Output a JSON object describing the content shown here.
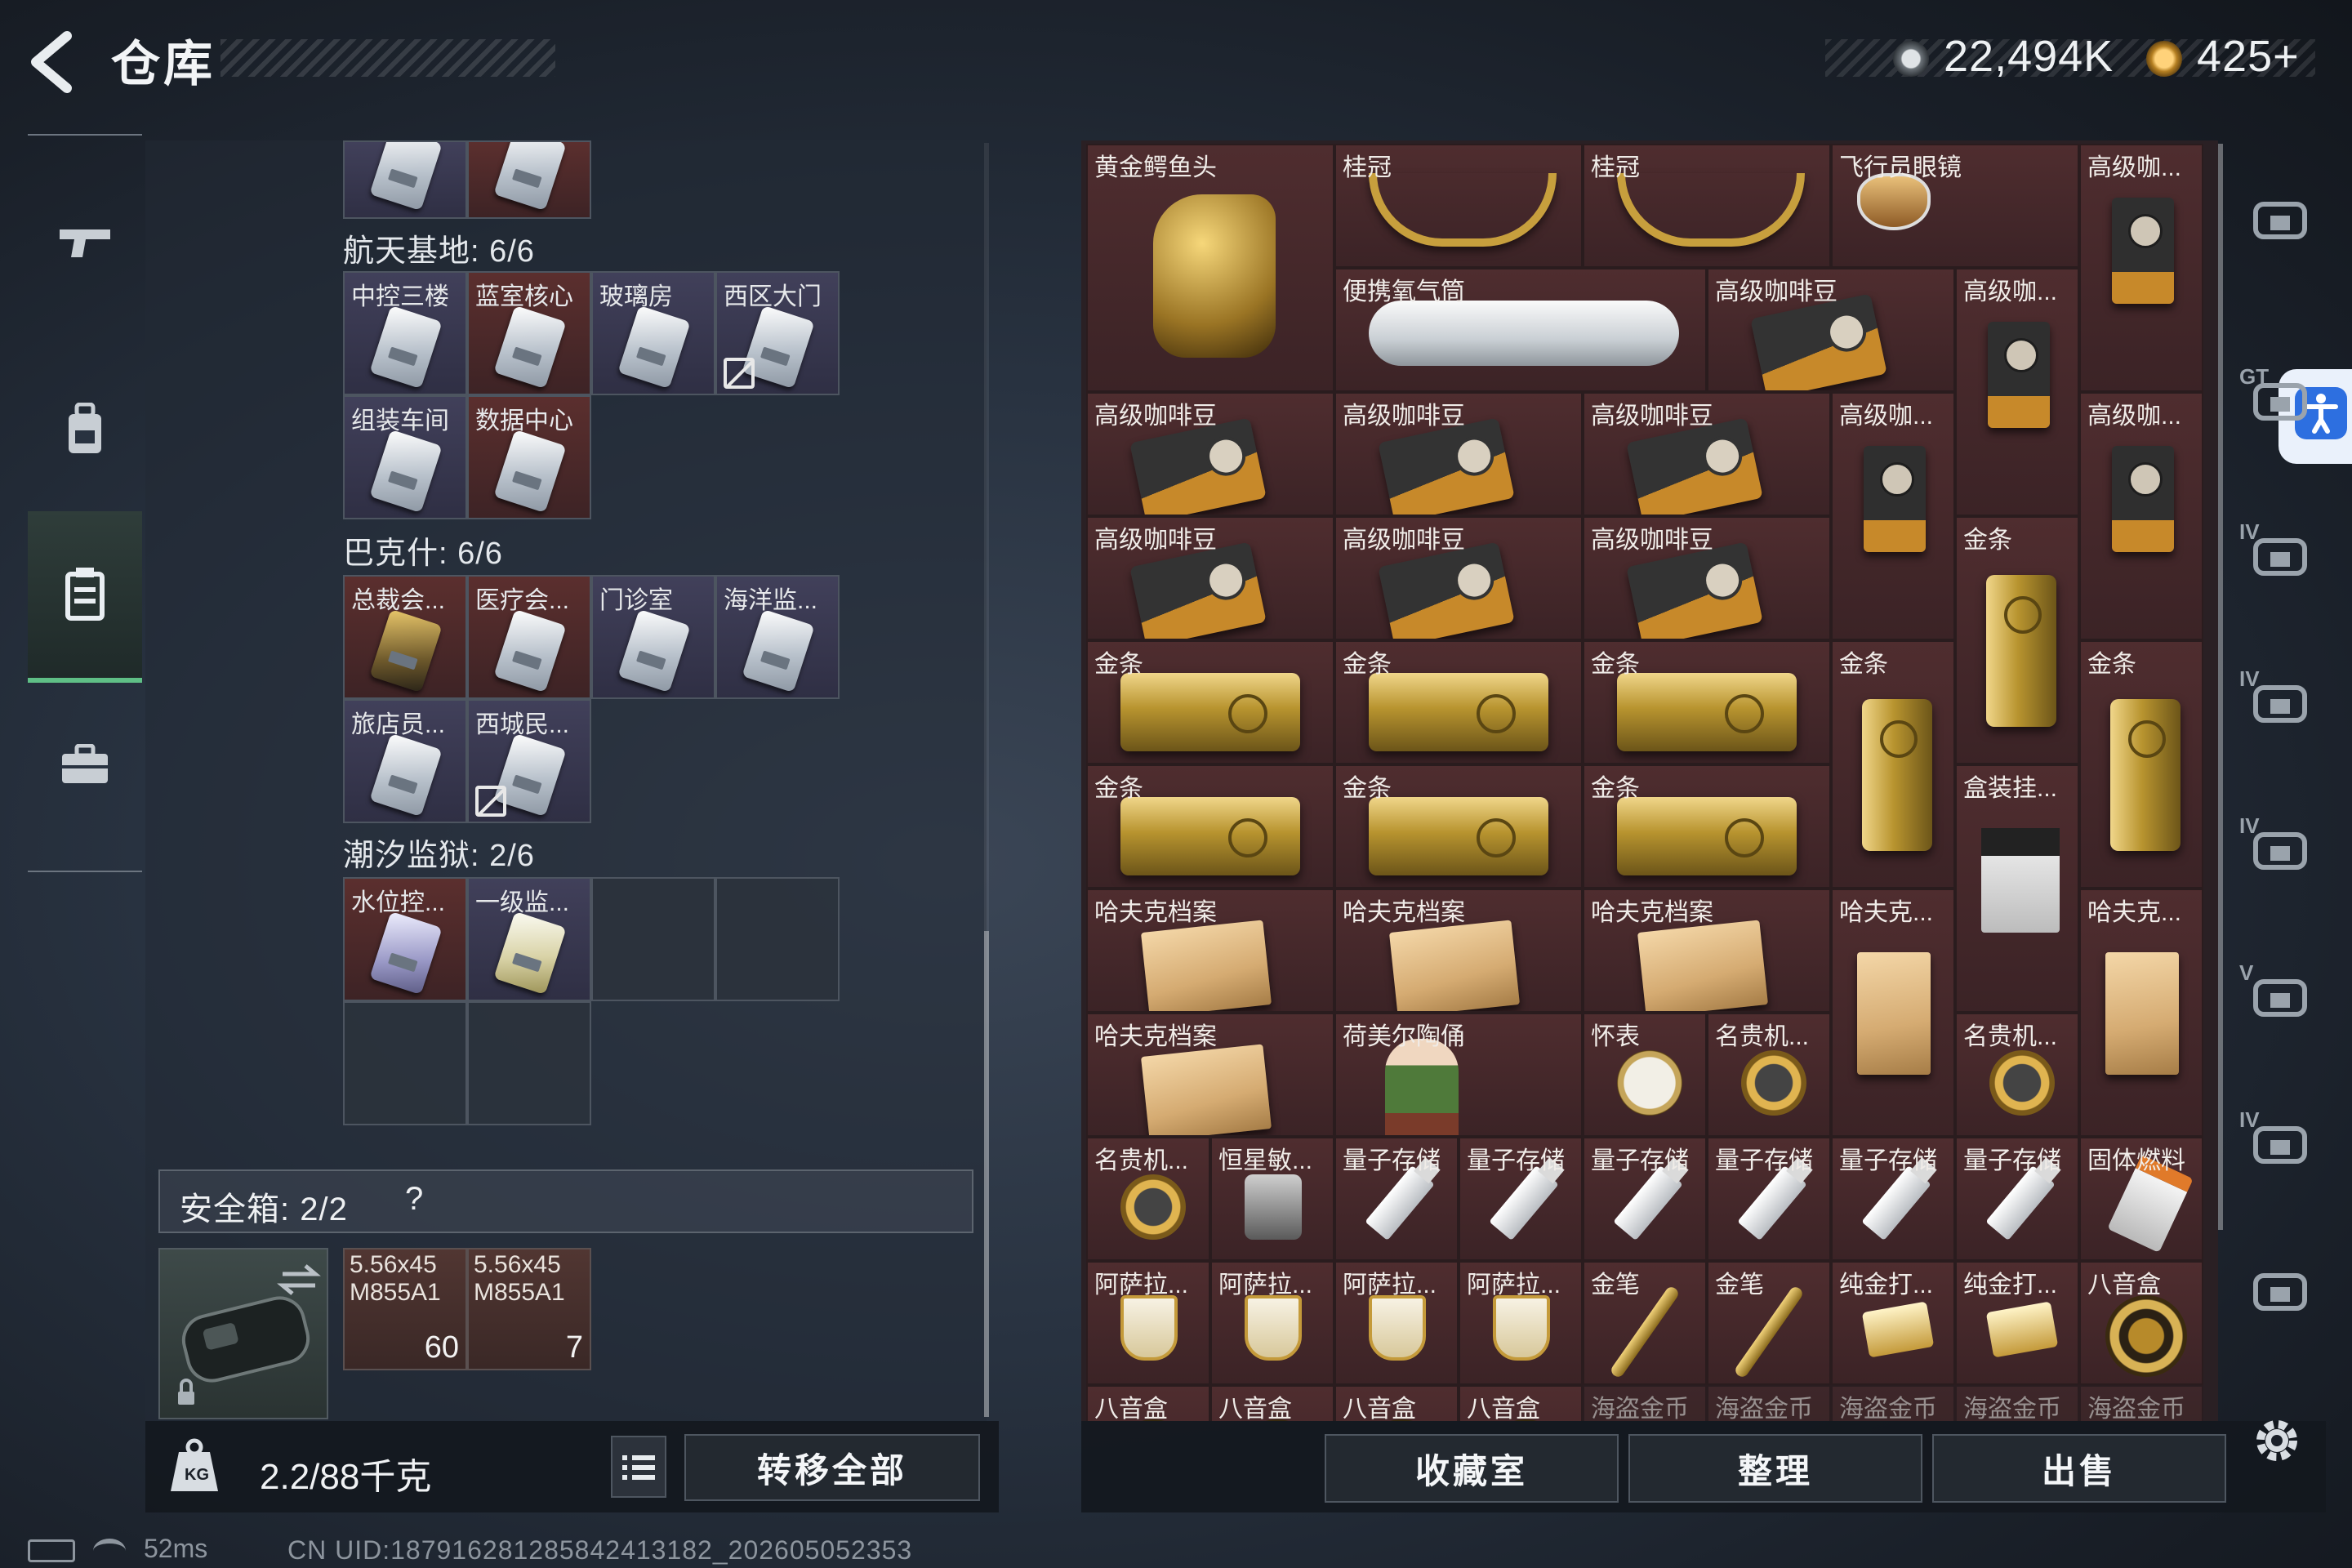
{
  "header": {
    "title": "仓库",
    "currency_1": "22,494K",
    "currency_2": "425+",
    "colors": {
      "accent_green": "#5fbf86",
      "slot_red": "#4f2d2f",
      "accessibility_blue": "#2d6fe0"
    }
  },
  "left_nav": {
    "items": [
      {
        "icon": "gun-icon"
      },
      {
        "icon": "backpack-icon"
      },
      {
        "icon": "container-icon",
        "active": true
      },
      {
        "icon": "briefcase-icon"
      }
    ]
  },
  "stash_sections": [
    {
      "title": "",
      "slots": [
        {
          "label": "",
          "style": "purple"
        },
        {
          "label": "",
          "style": "red"
        }
      ]
    },
    {
      "title": "航天基地: 6/6",
      "slots": [
        {
          "label": "中控三楼",
          "style": "purple"
        },
        {
          "label": "蓝室核心",
          "style": "red"
        },
        {
          "label": "玻璃房",
          "style": "purple"
        },
        {
          "label": "西区大门",
          "style": "purple",
          "nodrop": true
        },
        {
          "label": "组装车间",
          "style": "purple"
        },
        {
          "label": "数据中心",
          "style": "red"
        }
      ]
    },
    {
      "title": "巴克什: 6/6",
      "slots": [
        {
          "label": "总裁会...",
          "style": "red",
          "card": "gold"
        },
        {
          "label": "医疗会...",
          "style": "red"
        },
        {
          "label": "门诊室",
          "style": "purple"
        },
        {
          "label": "海洋监...",
          "style": "purple"
        },
        {
          "label": "旅店员...",
          "style": "purple"
        },
        {
          "label": "西城民...",
          "style": "purple",
          "nodrop": true
        }
      ]
    },
    {
      "title": "潮汐监狱: 2/6",
      "slots": [
        {
          "label": "水位控...",
          "style": "red",
          "card": "purple"
        },
        {
          "label": "一级监...",
          "style": "purple",
          "card": "yellow"
        }
      ]
    }
  ],
  "safe_box": {
    "label": "安全箱: 2/2",
    "help": "?",
    "ammo": [
      {
        "name": "5.56x45 M855A1",
        "count": "60"
      },
      {
        "name": "5.56x45 M855A1",
        "count": "7"
      }
    ]
  },
  "left_bottom": {
    "weight": "2.2/88千克",
    "transfer_label": "转移全部"
  },
  "status": {
    "ping": "52ms",
    "uid": "CN UID:18791628128584241318​2_202605052353"
  },
  "stash_items": [
    {
      "label": "黄金鳄鱼头",
      "art": "croc"
    },
    {
      "label": "桂冠",
      "art": "laurel"
    },
    {
      "label": "桂冠",
      "art": "laurel"
    },
    {
      "label": "飞行员眼镜",
      "art": "glasses"
    },
    {
      "label": "高级咖...",
      "art": "coffee-up"
    },
    {
      "label": "便携氧气筒",
      "art": "oxygen"
    },
    {
      "label": "高级咖啡豆",
      "art": "coffee-bag"
    },
    {
      "label": "高级咖...",
      "art": "coffee-up"
    },
    {
      "label": "高级咖啡豆",
      "art": "coffee-bag"
    },
    {
      "label": "高级咖啡豆",
      "art": "coffee-bag"
    },
    {
      "label": "高级咖啡豆",
      "art": "coffee-bag"
    },
    {
      "label": "高级咖...",
      "art": "coffee-up"
    },
    {
      "label": "高级咖...",
      "art": "coffee-up"
    },
    {
      "label": "高级咖啡豆",
      "art": "coffee-bag"
    },
    {
      "label": "高级咖啡豆",
      "art": "coffee-bag"
    },
    {
      "label": "高级咖啡豆",
      "art": "coffee-bag"
    },
    {
      "label": "金条",
      "art": "gold-v"
    },
    {
      "label": "金条",
      "art": "gold-h"
    },
    {
      "label": "金条",
      "art": "gold-h"
    },
    {
      "label": "金条",
      "art": "gold-h"
    },
    {
      "label": "金条",
      "art": "gold-v"
    },
    {
      "label": "金条",
      "art": "gold-v"
    },
    {
      "label": "金条",
      "art": "gold-h"
    },
    {
      "label": "金条",
      "art": "gold-h"
    },
    {
      "label": "金条",
      "art": "gold-h"
    },
    {
      "label": "盒装挂...",
      "art": "boxcoffee"
    },
    {
      "label": "哈夫克档案",
      "art": "folder"
    },
    {
      "label": "哈夫克档案",
      "art": "folder"
    },
    {
      "label": "哈夫克档案",
      "art": "folder"
    },
    {
      "label": "哈夫克...",
      "art": "folder-v"
    },
    {
      "label": "哈夫克...",
      "art": "folder-v"
    },
    {
      "label": "哈夫克档案",
      "art": "folder"
    },
    {
      "label": "荷美尔陶俑",
      "art": "figurine"
    },
    {
      "label": "怀表",
      "art": "pocketwatch"
    },
    {
      "label": "名贵机...",
      "art": "watch"
    },
    {
      "label": "名贵机...",
      "art": "watch"
    },
    {
      "label": "名贵机...",
      "art": "watch"
    },
    {
      "label": "恒星敏...",
      "art": "camera"
    },
    {
      "label": "量子存储",
      "art": "usb"
    },
    {
      "label": "量子存储",
      "art": "usb"
    },
    {
      "label": "量子存储",
      "art": "usb"
    },
    {
      "label": "量子存储",
      "art": "usb"
    },
    {
      "label": "量子存储",
      "art": "usb"
    },
    {
      "label": "量子存储",
      "art": "usb"
    },
    {
      "label": "固体燃料",
      "art": "fuel"
    },
    {
      "label": "阿萨拉...",
      "art": "cup"
    },
    {
      "label": "阿萨拉...",
      "art": "cup"
    },
    {
      "label": "阿萨拉...",
      "art": "cup"
    },
    {
      "label": "阿萨拉...",
      "art": "cup"
    },
    {
      "label": "金笔",
      "art": "pen"
    },
    {
      "label": "金笔",
      "art": "pen"
    },
    {
      "label": "纯金打...",
      "art": "lighter"
    },
    {
      "label": "纯金打...",
      "art": "lighter"
    },
    {
      "label": "八音盒",
      "art": "musicbox"
    },
    {
      "label": "八音盒",
      "art": "musicbox"
    },
    {
      "label": "八音盒",
      "art": "musicbox"
    },
    {
      "label": "八音盒",
      "art": "musicbox"
    },
    {
      "label": "八音盒",
      "art": "musicbox"
    },
    {
      "label": "海盗金币",
      "art": "none"
    },
    {
      "label": "海盗金币",
      "art": "none"
    },
    {
      "label": "海盗金币",
      "art": "none"
    },
    {
      "label": "海盗金币",
      "art": "none"
    },
    {
      "label": "海盗金币",
      "art": "none"
    }
  ],
  "right_bottom": {
    "collection_label": "收藏室",
    "sort_label": "整理",
    "sell_label": "出售"
  },
  "right_side": {
    "tabs": [
      {
        "icon": "helmet-icon",
        "tag": ""
      },
      {
        "icon": "chest-rig-icon",
        "tag": "GT"
      },
      {
        "icon": "truck-icon",
        "tag": "IV"
      },
      {
        "icon": "folder-icon",
        "tag": "IV"
      },
      {
        "icon": "medkit-icon",
        "tag": "IV"
      },
      {
        "icon": "camera-icon",
        "tag": "V"
      },
      {
        "icon": "camera-gear-icon",
        "tag": "IV"
      },
      {
        "icon": "camera-gear-icon",
        "tag": ""
      }
    ]
  }
}
